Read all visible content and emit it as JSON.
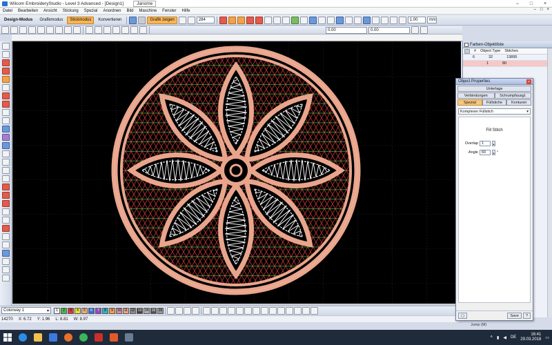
{
  "window": {
    "title": "Wilcom EmbroideryStudio - Level 3 Advanced - [Design1]",
    "tab_name": "Janome",
    "controls": [
      "–",
      "□",
      "×"
    ]
  },
  "menu": [
    "Datei",
    "Bearbeiten",
    "Ansicht",
    "Stickung",
    "Spezial",
    "Anordnen",
    "Bild",
    "Maschine",
    "Fenster",
    "Hilfe"
  ],
  "mdi_controls": [
    "–",
    "□",
    "×"
  ],
  "toolbar1": {
    "design_mode": "Design-Modus",
    "graphic_mode": "Grafikmodus",
    "stitch_mode": "Stickmodus",
    "convert": "Konvertieren",
    "show_graphic": "Grafik zeigen",
    "zoom_value": "284",
    "scale_value": "1.00",
    "unit": "mm"
  },
  "toolbar2": {
    "field1": "0.00",
    "field2": "0.00"
  },
  "colorbar": {
    "colorway": "Colorway 1",
    "swatches": [
      {
        "label": "1",
        "color": "#f2f2f2"
      },
      {
        "label": "2",
        "color": "#4ab84a"
      },
      {
        "label": "3",
        "color": "#d63b3b"
      },
      {
        "label": "4",
        "color": "#e6e23a"
      },
      {
        "label": "5",
        "color": "#f0b07a"
      },
      {
        "label": "6",
        "color": "#3a6fd6"
      },
      {
        "label": "7",
        "color": "#8f4cc2"
      },
      {
        "label": "8",
        "color": "#2fb4c8"
      },
      {
        "label": "9",
        "color": "#f3a04a"
      },
      {
        "label": "10",
        "color": "#d68fa5"
      },
      {
        "label": "11",
        "color": "#e9a58c"
      },
      {
        "label": "12",
        "color": "#8c8c8c"
      },
      {
        "label": "13",
        "color": "#444444"
      },
      {
        "label": "14",
        "color": "#b0b0b0"
      },
      {
        "label": "15",
        "color": "#555555"
      },
      {
        "label": "16",
        "color": "#999999"
      }
    ]
  },
  "status": {
    "stitches": "14270",
    "x": "X: 6.72",
    "y": "Y: 1.96",
    "l": "L: 8.81",
    "w": "W: 8.97"
  },
  "color_object_list": {
    "title": "Farben-Objektliste",
    "columns": [
      "#",
      "Object Type",
      "Stitches"
    ],
    "rows": [
      {
        "n": "6",
        "obj": "32",
        "stitches": "13895",
        "selected": false
      },
      {
        "n": "",
        "obj": "1",
        "stitches": "80",
        "selected": true
      }
    ]
  },
  "object_properties": {
    "title": "Object Properties",
    "tab_top": "Unterlage",
    "tabs_row2": [
      "Verbindungen",
      "Schrumpfausgl."
    ],
    "tabs_row3": [
      "Spezial",
      "Füllstiche",
      "Konturen"
    ],
    "fill_type": "Komplexer Füllstich",
    "fill_title": "Fill Stitch",
    "overlap_label": "Overlap",
    "overlap_value": "1",
    "angle_label": "Angle",
    "angle_value": "60",
    "angle_unit": "°",
    "save_label": "Save",
    "help_label": "?"
  },
  "jump_label": "Jump (M)",
  "taskbar": {
    "lang": "DE",
    "time": "16:41",
    "date": "29.03.2018"
  },
  "design": {
    "outline_color": "#e9a58c",
    "petal_fill_color": "#f2f2f2",
    "background_fill_color": "#000000",
    "lattice_colors": [
      "#d63b3b",
      "#4ab84a",
      "#e6e23a"
    ],
    "petal_count": 8
  }
}
